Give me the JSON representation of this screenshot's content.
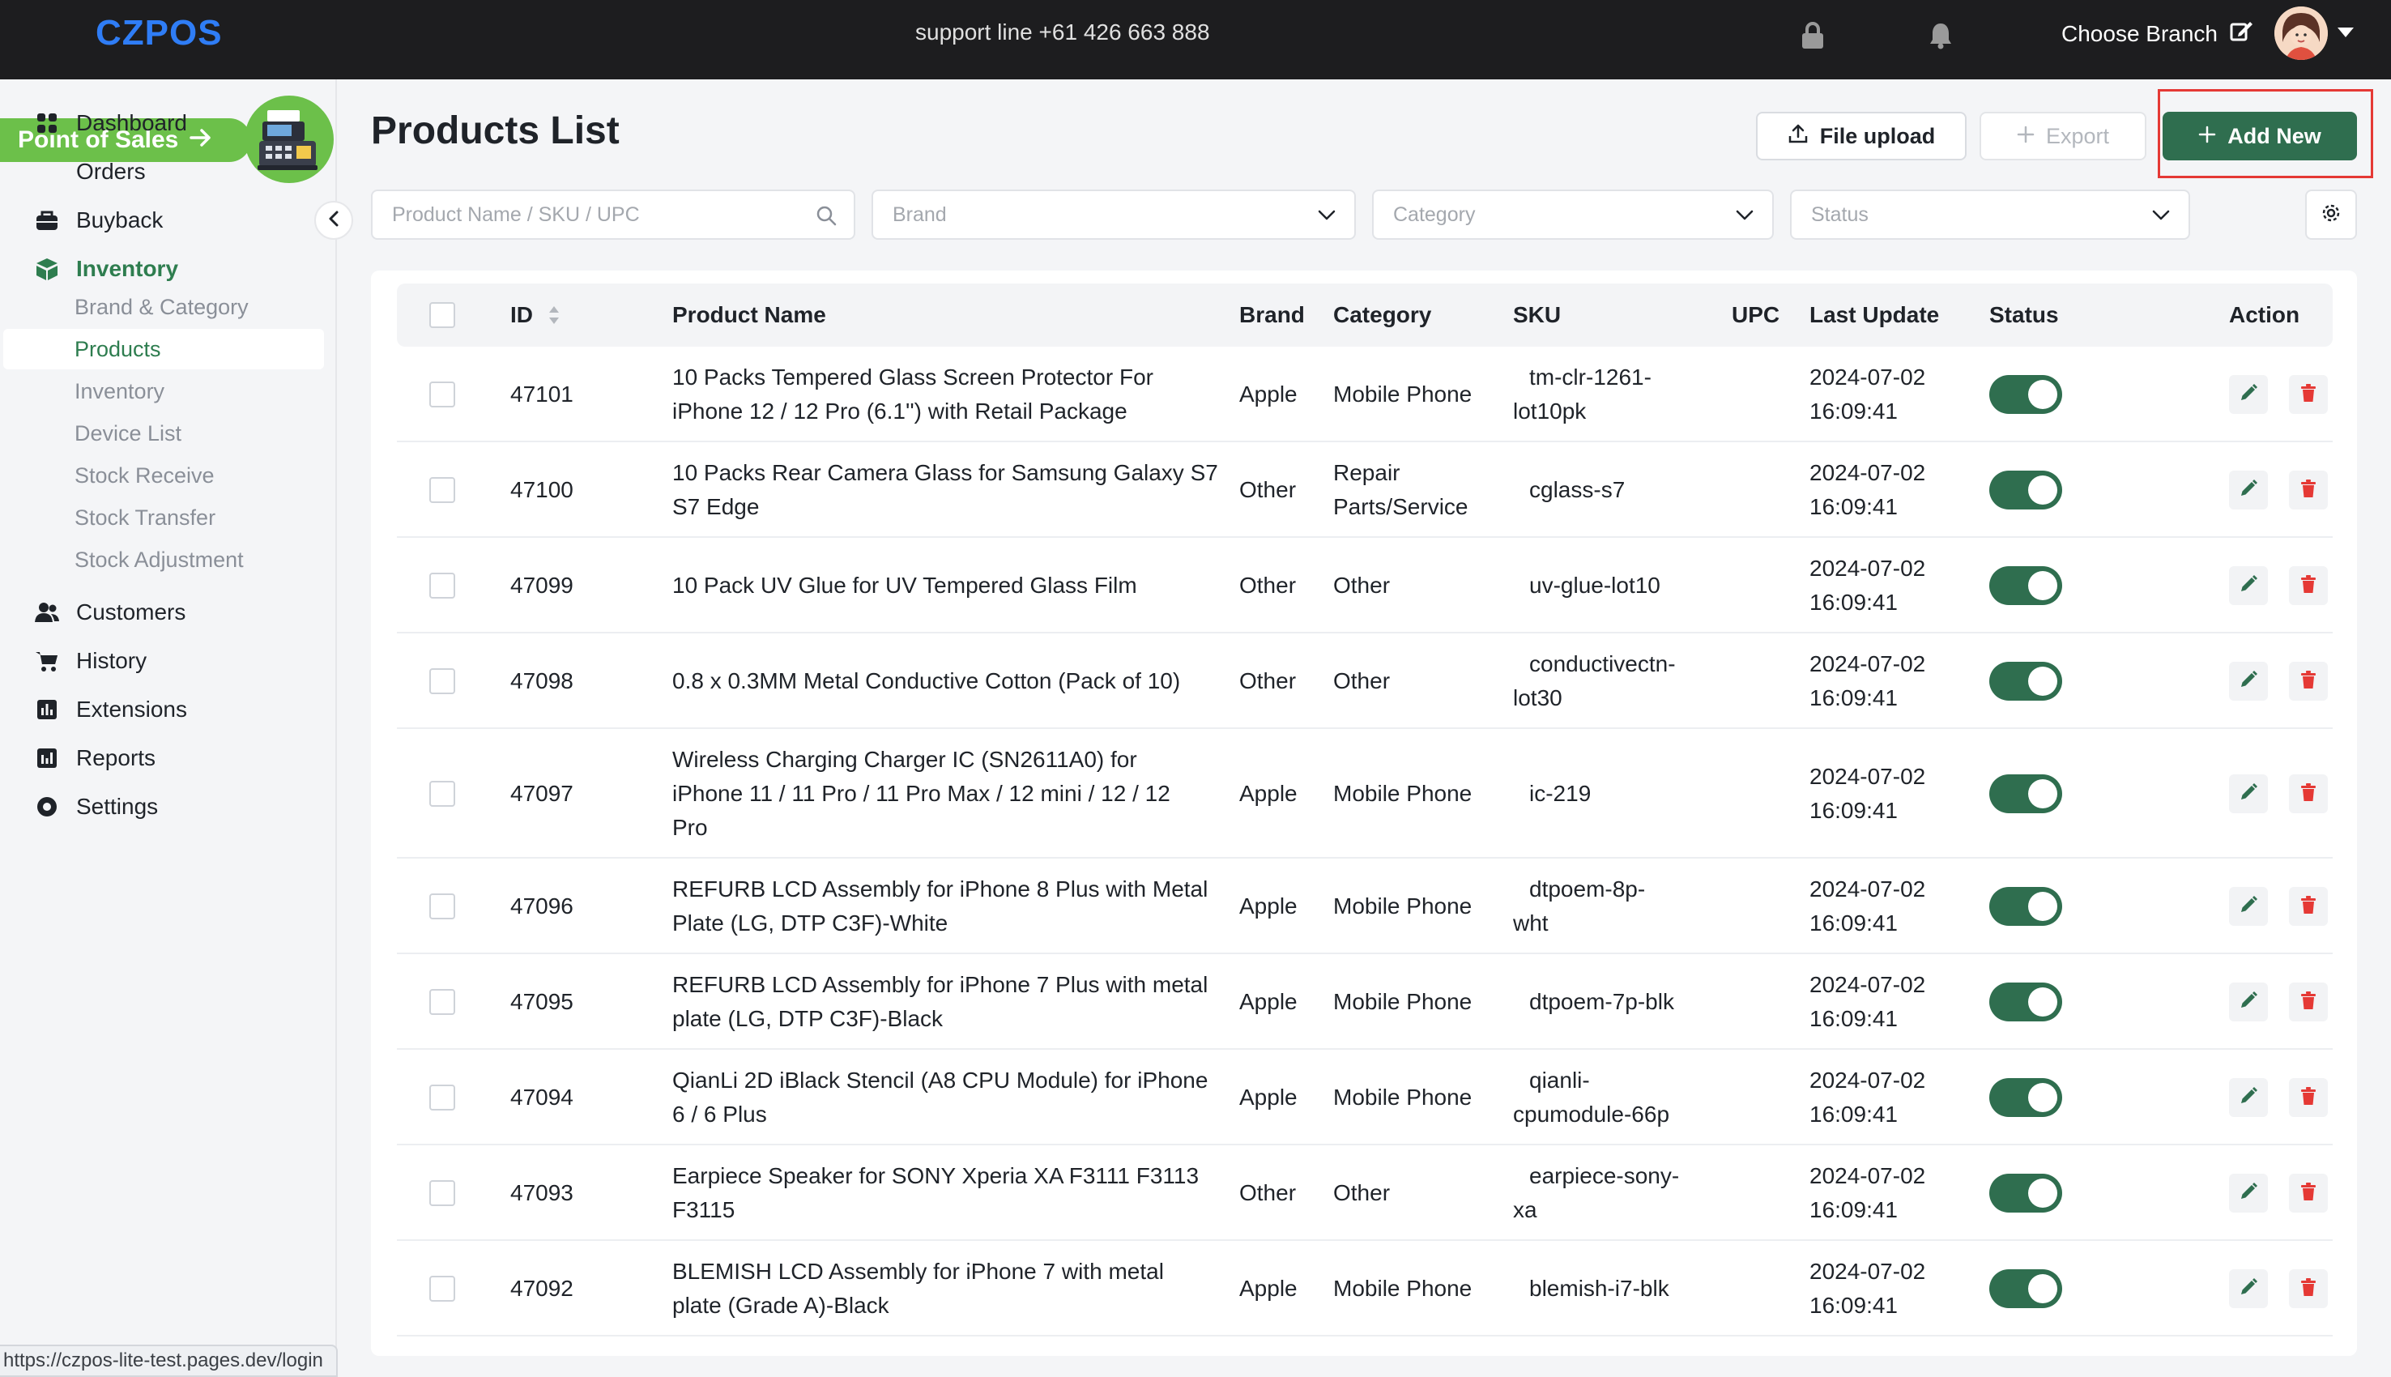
{
  "header": {
    "logo": "CZPOS",
    "support": "support line +61 426 663 888",
    "choose_branch": "Choose Branch",
    "icons": [
      "lock-icon",
      "bell-icon",
      "edit-icon",
      "avatar",
      "chevron-down-icon"
    ]
  },
  "sidebar": {
    "pos_label": "Point of Sales",
    "items": [
      {
        "label": "Dashboard",
        "icon": "dashboard-icon"
      },
      {
        "label": "Orders",
        "icon": ""
      },
      {
        "label": "Buyback",
        "icon": "buyback-icon"
      },
      {
        "label": "Inventory",
        "icon": "inventory-icon",
        "active": true
      },
      {
        "label": "Customers",
        "icon": "customers-icon"
      },
      {
        "label": "History",
        "icon": "cart-icon"
      },
      {
        "label": "Extensions",
        "icon": "extensions-icon"
      },
      {
        "label": "Reports",
        "icon": "reports-icon"
      },
      {
        "label": "Settings",
        "icon": "settings-icon"
      }
    ],
    "sub_items": [
      "Brand & Category",
      "Products",
      "Inventory",
      "Device List",
      "Stock Receive",
      "Stock Transfer",
      "Stock Adjustment"
    ],
    "active_sub": "Products"
  },
  "page": {
    "title": "Products List",
    "file_upload": "File upload",
    "export": "Export",
    "add_new": "Add New"
  },
  "filters": {
    "search_placeholder": "Product Name / SKU / UPC",
    "brand": "Brand",
    "category": "Category",
    "status": "Status"
  },
  "table": {
    "headers": {
      "id": "ID",
      "name": "Product Name",
      "brand": "Brand",
      "category": "Category",
      "sku": "SKU",
      "upc": "UPC",
      "updated": "Last Update",
      "status": "Status",
      "action": "Action"
    },
    "rows": [
      {
        "id": "47101",
        "name": [
          "10 Packs Tempered Glass Screen Protector For",
          "iPhone 12 / 12 Pro (6.1'') with Retail Package"
        ],
        "brand": "Apple",
        "category": [
          "Mobile Phone"
        ],
        "sku": [
          "tm-clr-1261-",
          "lot10pk"
        ],
        "date": "2024-07-02",
        "time": "16:09:41",
        "status": true
      },
      {
        "id": "47100",
        "name": [
          "10 Packs Rear Camera Glass for Samsung Galaxy S7",
          "S7 Edge"
        ],
        "brand": "Other",
        "category": [
          "Repair",
          "Parts/Service"
        ],
        "sku": [
          "cglass-s7"
        ],
        "date": "2024-07-02",
        "time": "16:09:41",
        "status": true
      },
      {
        "id": "47099",
        "name": [
          "10 Pack UV Glue for UV Tempered Glass Film"
        ],
        "brand": "Other",
        "category": [
          "Other"
        ],
        "sku": [
          "uv-glue-lot10"
        ],
        "date": "2024-07-02",
        "time": "16:09:41",
        "status": true
      },
      {
        "id": "47098",
        "name": [
          "0.8 x 0.3MM Metal Conductive Cotton (Pack of 10)"
        ],
        "brand": "Other",
        "category": [
          "Other"
        ],
        "sku": [
          "conductivectn-",
          "lot30"
        ],
        "date": "2024-07-02",
        "time": "16:09:41",
        "status": true
      },
      {
        "id": "47097",
        "name": [
          "Wireless Charging Charger IC (SN2611A0) for",
          "iPhone 11 / 11 Pro / 11 Pro Max / 12 mini / 12 / 12",
          "Pro"
        ],
        "brand": "Apple",
        "category": [
          "Mobile Phone"
        ],
        "sku": [
          "ic-219"
        ],
        "date": "2024-07-02",
        "time": "16:09:41",
        "status": true
      },
      {
        "id": "47096",
        "name": [
          "REFURB LCD Assembly for iPhone 8 Plus with Metal",
          "Plate (LG, DTP C3F)-White"
        ],
        "brand": "Apple",
        "category": [
          "Mobile Phone"
        ],
        "sku": [
          "dtpoem-8p-",
          "wht"
        ],
        "date": "2024-07-02",
        "time": "16:09:41",
        "status": true
      },
      {
        "id": "47095",
        "name": [
          "REFURB LCD Assembly for iPhone 7 Plus with metal",
          "plate (LG, DTP C3F)-Black"
        ],
        "brand": "Apple",
        "category": [
          "Mobile Phone"
        ],
        "sku": [
          "dtpoem-7p-blk"
        ],
        "date": "2024-07-02",
        "time": "16:09:41",
        "status": true
      },
      {
        "id": "47094",
        "name": [
          "QianLi 2D iBlack Stencil (A8 CPU Module) for iPhone",
          "6 / 6 Plus"
        ],
        "brand": "Apple",
        "category": [
          "Mobile Phone"
        ],
        "sku": [
          "qianli-",
          "cpumodule-66p"
        ],
        "date": "2024-07-02",
        "time": "16:09:41",
        "status": true
      },
      {
        "id": "47093",
        "name": [
          "Earpiece Speaker for SONY Xperia XA F3111 F3113",
          "F3115"
        ],
        "brand": "Other",
        "category": [
          "Other"
        ],
        "sku": [
          "earpiece-sony-",
          "xa"
        ],
        "date": "2024-07-02",
        "time": "16:09:41",
        "status": true
      },
      {
        "id": "47092",
        "name": [
          "BLEMISH LCD Assembly for iPhone 7 with metal",
          "plate (Grade A)-Black"
        ],
        "brand": "Apple",
        "category": [
          "Mobile Phone"
        ],
        "sku": [
          "blemish-i7-blk"
        ],
        "date": "2024-07-02",
        "time": "16:09:41",
        "status": true
      }
    ]
  },
  "status_url": "https://czpos-lite-test.pages.dev/login",
  "colors": {
    "accent": "#2f6e4f",
    "brand_blue": "#2f7df6",
    "pos_green": "#6cc04a",
    "delete_red": "#e53935"
  }
}
